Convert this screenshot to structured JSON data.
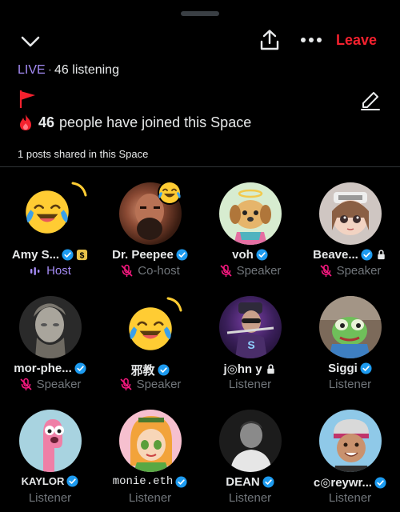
{
  "header": {
    "leave_label": "Leave"
  },
  "status": {
    "live_label": "LIVE",
    "separator": "·",
    "listening_text": "46 listening"
  },
  "joined": {
    "count": "46",
    "text": "people have joined this Space"
  },
  "posts_shared": "1 posts shared in this Space",
  "colors": {
    "accent_live": "#a48bf5",
    "leave_red": "#f4212e",
    "verified_blue": "#1d9bf0",
    "muted_pink": "#f91880",
    "secondary_text": "#71767b"
  },
  "participants": [
    {
      "name": "Amy S...",
      "role": "Host",
      "role_icon": "audio-bars-icon",
      "verified": true,
      "extra_badge": "dollar-badge-icon"
    },
    {
      "name": "Dr. Peepee",
      "role": "Co-host",
      "role_icon": "mic-muted-icon",
      "verified": true
    },
    {
      "name": "voh",
      "role": "Speaker",
      "role_icon": "mic-muted-icon",
      "verified": true
    },
    {
      "name": "Beave...",
      "role": "Speaker",
      "role_icon": "mic-muted-icon",
      "verified": true,
      "extra_badge": "lock-icon"
    },
    {
      "name": "mor-phe...",
      "role": "Speaker",
      "role_icon": "mic-muted-icon",
      "verified": true
    },
    {
      "name": "邪教",
      "role": "Speaker",
      "role_icon": "mic-muted-icon",
      "verified": true
    },
    {
      "name": "j◎hn y",
      "role": "Listener",
      "verified": false,
      "extra_badge": "lock-icon"
    },
    {
      "name": "Siggi",
      "role": "Listener",
      "verified": true
    },
    {
      "name": "KAYLOR",
      "role": "Listener",
      "verified": true
    },
    {
      "name": "monie.eth",
      "role": "Listener",
      "verified": true
    },
    {
      "name": "DEAN",
      "role": "Listener",
      "verified": true
    },
    {
      "name": "c◎reywr...",
      "role": "Listener",
      "verified": true
    }
  ]
}
